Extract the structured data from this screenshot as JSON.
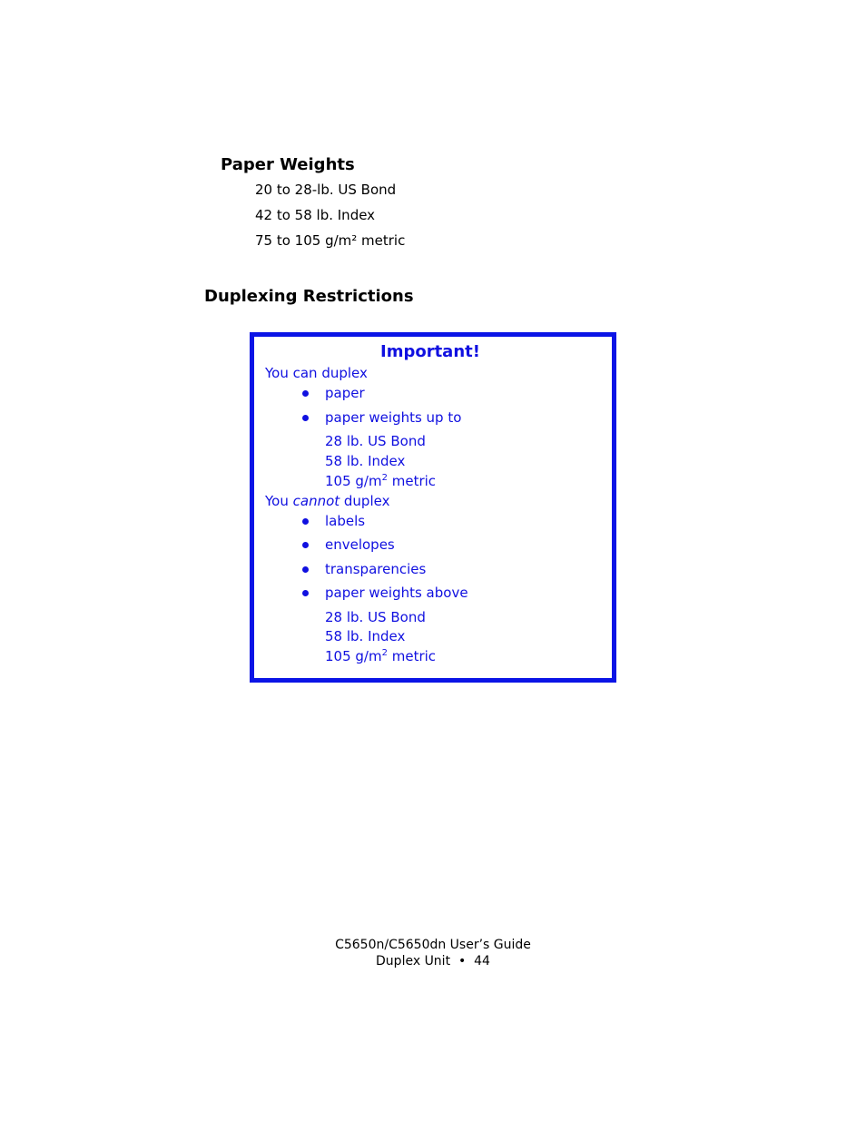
{
  "paper_weights": {
    "heading": "Paper Weights",
    "items": [
      "20 to 28-lb. US Bond",
      "42 to 58 lb. Index",
      "75 to 105 g/m² metric"
    ]
  },
  "duplexing": {
    "heading": "Duplexing Restrictions",
    "important": {
      "title": "Important!",
      "can_intro": "You can duplex",
      "can_items": [
        "paper",
        "paper weights up to"
      ],
      "can_limits": [
        "28 lb. US Bond",
        "58 lb. Index",
        "105 g/m",
        "2",
        " metric"
      ],
      "cannot_intro_pre": "You ",
      "cannot_intro_em": "cannot",
      "cannot_intro_post": " duplex",
      "cannot_items": [
        "labels",
        "envelopes",
        "transparencies",
        "paper weights above"
      ],
      "cannot_limits": [
        "28 lb. US Bond",
        "58 lb. Index",
        "105 g/m",
        "2",
        " metric"
      ]
    }
  },
  "footer": {
    "guide": "C5650n/C5650dn User’s Guide",
    "section": "Duplex Unit",
    "separator": "•",
    "page": "44"
  }
}
